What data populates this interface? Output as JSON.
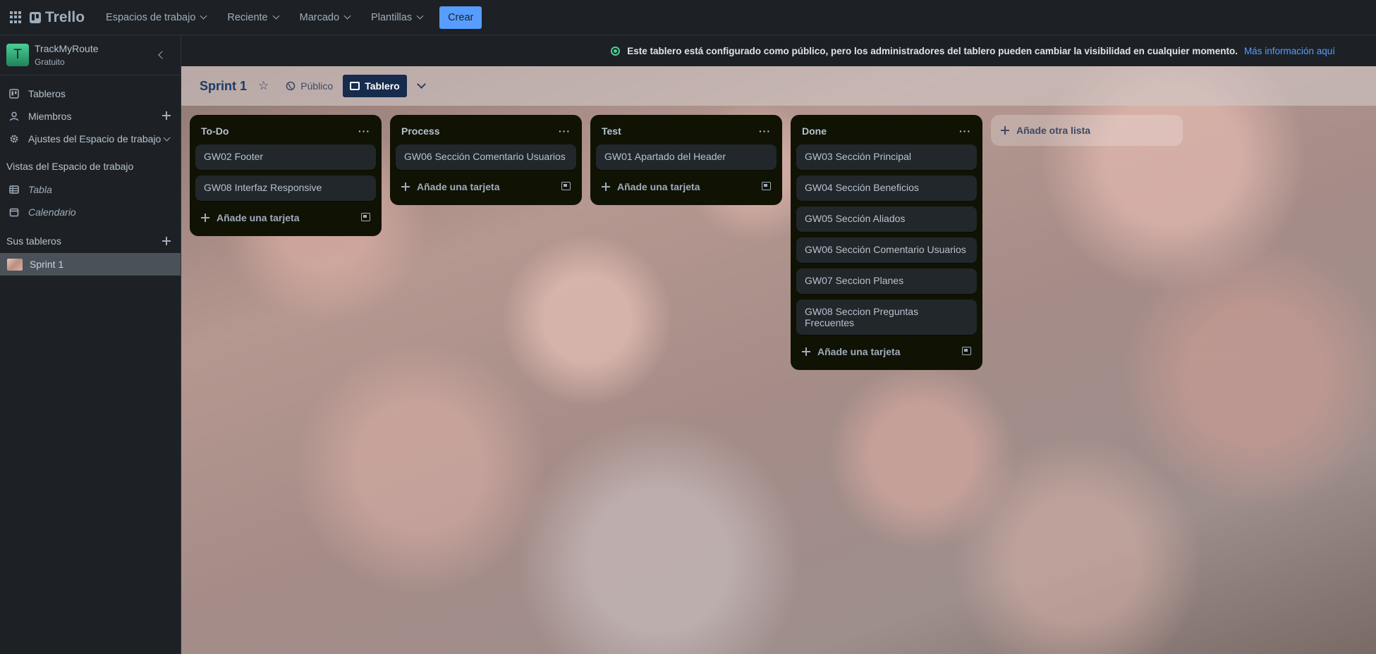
{
  "topbar": {
    "logo_text": "Trello",
    "nav": [
      {
        "label": "Espacios de trabajo"
      },
      {
        "label": "Reciente"
      },
      {
        "label": "Marcado"
      },
      {
        "label": "Plantillas"
      }
    ],
    "create_label": "Crear"
  },
  "sidebar": {
    "workspace_initial": "T",
    "workspace_name": "TrackMyRoute",
    "workspace_plan": "Gratuito",
    "items": [
      {
        "label": "Tableros",
        "icon": "board-icon"
      },
      {
        "label": "Miembros",
        "icon": "person-icon"
      },
      {
        "label": "Ajustes del Espacio de trabajo",
        "icon": "gear-icon"
      }
    ],
    "views_heading": "Vistas del Espacio de trabajo",
    "views": [
      {
        "label": "Tabla",
        "icon": "table-icon"
      },
      {
        "label": "Calendario",
        "icon": "calendar-icon"
      }
    ],
    "boards_heading": "Sus tableros",
    "boards": [
      {
        "label": "Sprint 1"
      }
    ]
  },
  "banner": {
    "text": "Este tablero está configurado como público, pero los administradores del tablero pueden cambiar la visibilidad en cualquier momento.",
    "link": "Más información aquí"
  },
  "board": {
    "title": "Sprint 1",
    "visibility_label": "Público",
    "view_label": "Tablero",
    "add_list_label": "Añade otra lista",
    "add_card_label": "Añade una tarjeta",
    "lists": [
      {
        "title": "To-Do",
        "cards": [
          "GW02 Footer",
          "GW08 Interfaz Responsive"
        ]
      },
      {
        "title": "Process",
        "cards": [
          "GW06 Sección Comentario Usuarios"
        ]
      },
      {
        "title": "Test",
        "cards": [
          "GW01 Apartado del Header"
        ]
      },
      {
        "title": "Done",
        "cards": [
          "GW03 Sección Principal",
          "GW04 Sección Beneficios",
          "GW05 Sección Aliados",
          "GW06 Sección Comentario Usuarios",
          "GW07 Seccion Planes",
          "GW08 Seccion Preguntas Frecuentes"
        ]
      }
    ]
  },
  "colors": {
    "accent": "#579dff",
    "background_dark": "#1d2125",
    "list_bg": "#101204",
    "card_bg": "#22272b",
    "public_green": "#4bce97"
  }
}
